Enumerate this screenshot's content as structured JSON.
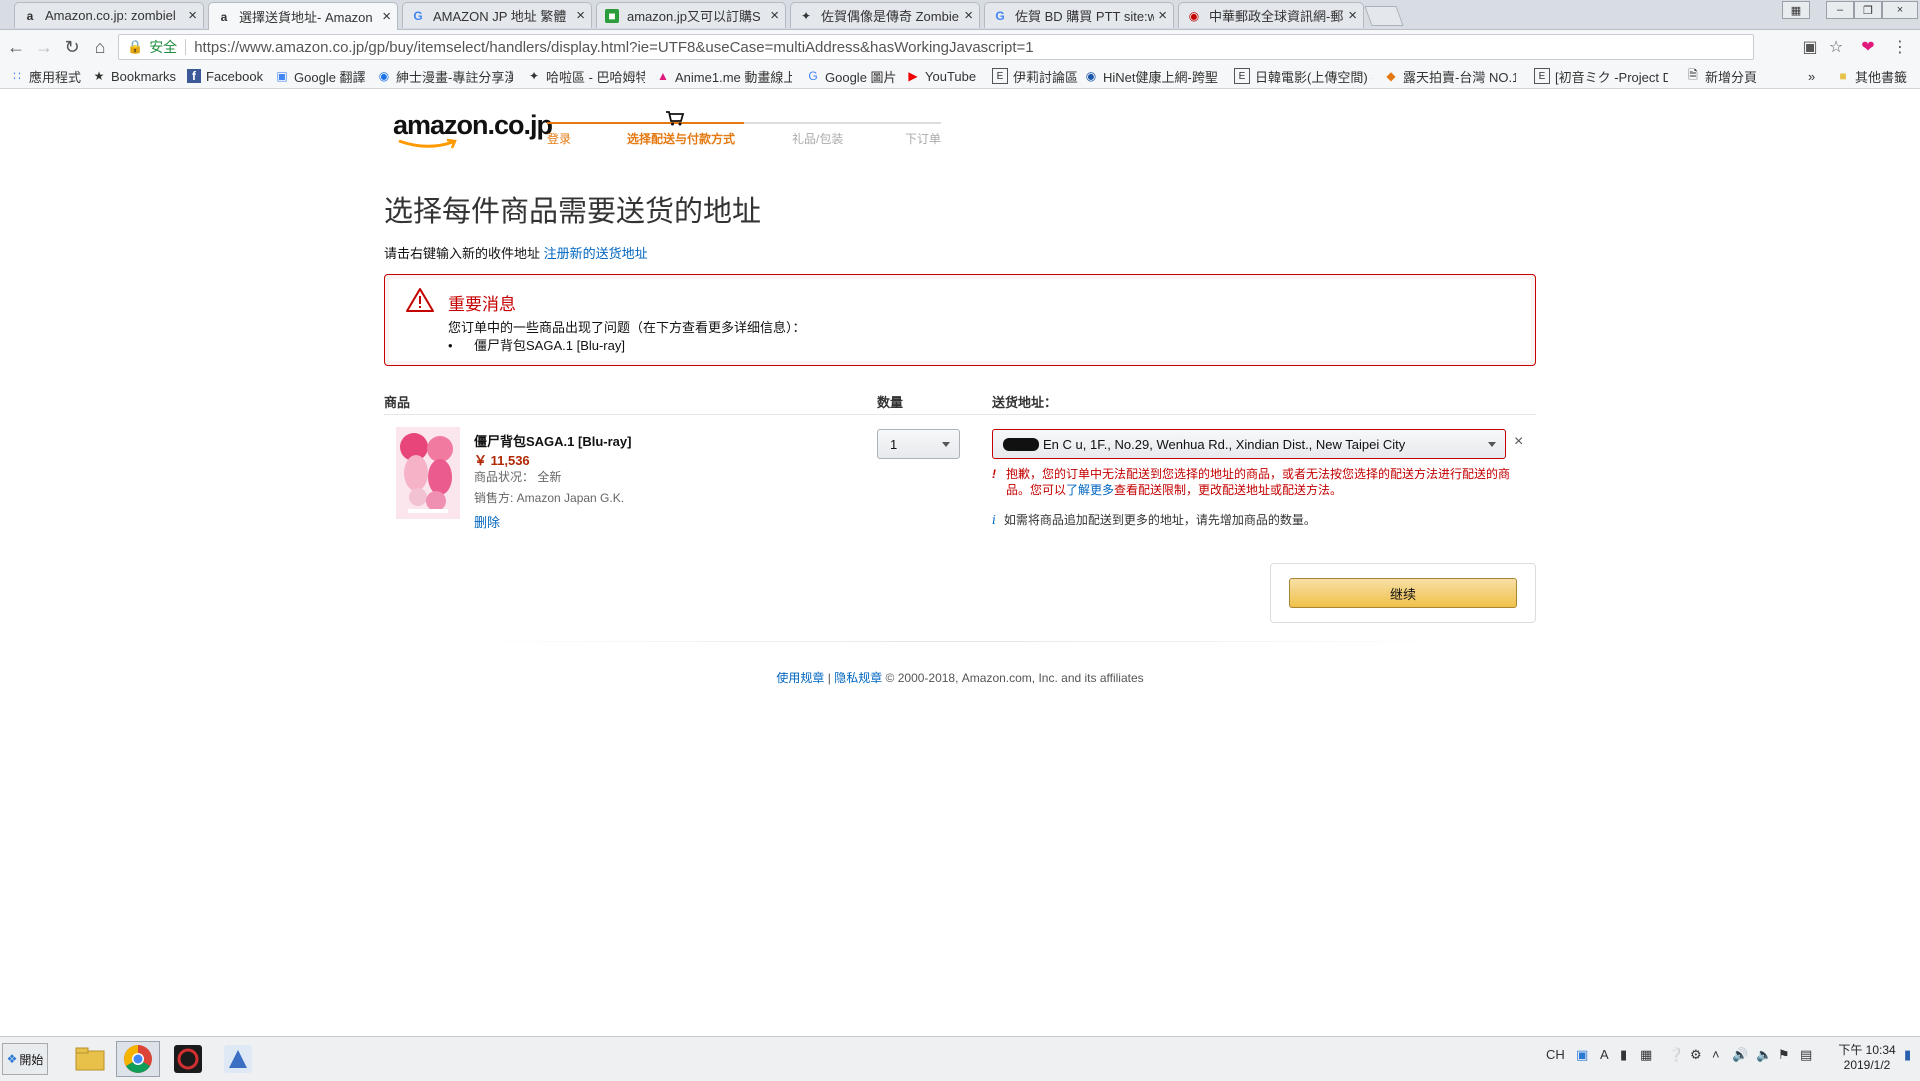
{
  "browser": {
    "tabs": [
      {
        "title": "Amazon.co.jp: zombiel",
        "favicon": "amazon-icon",
        "active": false
      },
      {
        "title": "選擇送貨地址- Amazon",
        "favicon": "amazon-icon",
        "active": true
      },
      {
        "title": "AMAZON JP 地址 繁體",
        "favicon": "google-icon",
        "active": false
      },
      {
        "title": "amazon.jp又可以訂購S",
        "favicon": "green-site-icon",
        "active": false
      },
      {
        "title": "佐賀偶像是傳奇 Zombie",
        "favicon": "bird-icon",
        "active": false
      },
      {
        "title": "佐賀 BD 購買 PTT site:w",
        "favicon": "google-icon",
        "active": false
      },
      {
        "title": "中華郵政全球資訊網-郵",
        "favicon": "post-icon",
        "active": false
      }
    ],
    "address_bar": {
      "security_label": "安全",
      "url": "https://www.amazon.co.jp/gp/buy/itemselect/handlers/display.html?ie=UTF8&useCase=multiAddress&hasWorkingJavascript=1"
    },
    "bookmarks": [
      {
        "label": "應用程式",
        "icon": "apps-grid-icon"
      },
      {
        "label": "Bookmarks",
        "icon": "star-icon"
      },
      {
        "label": "Facebook",
        "icon": "facebook-icon"
      },
      {
        "label": "Google 翻譯",
        "icon": "translate-icon"
      },
      {
        "label": "紳士漫畫-專註分享漢",
        "icon": "camera-icon"
      },
      {
        "label": "哈啦區 - 巴哈姆特",
        "icon": "bird-icon"
      },
      {
        "label": "Anime1.me 動畫線上",
        "icon": "anime-icon"
      },
      {
        "label": "Google 圖片",
        "icon": "google-icon"
      },
      {
        "label": "YouTube",
        "icon": "youtube-icon"
      },
      {
        "label": "伊莉討論區",
        "icon": "e-icon"
      },
      {
        "label": "HiNet健康上網-跨聖",
        "icon": "hinet-icon"
      },
      {
        "label": "日韓電影(上傳空間) -",
        "icon": "e-icon"
      },
      {
        "label": "露天拍賣-台灣 NO.1",
        "icon": "ruten-icon"
      },
      {
        "label": "[初音ミク -Project DI",
        "icon": "e-icon"
      },
      {
        "label": "新增分頁",
        "icon": "page-icon"
      }
    ],
    "bookmarks_more": "»",
    "other_bookmarks": "其他書籤"
  },
  "checkout": {
    "logo_text": "amazon.co.jp",
    "steps": [
      {
        "label": "登录",
        "state": "done"
      },
      {
        "label": "选择配送与付款方式",
        "state": "current"
      },
      {
        "label": "礼品/包装",
        "state": "pending"
      },
      {
        "label": "下订单",
        "state": "pending"
      }
    ],
    "progress_fraction": 0.5
  },
  "page": {
    "title": "选择每件商品需要送货的地址",
    "subline": "请击右键输入新的收件地址",
    "register_link": "注册新的送货地址"
  },
  "alert": {
    "title": "重要消息",
    "message": "您订单中的一些商品出现了问题（在下方查看更多详细信息）：",
    "items": [
      "僵尸背包SAGA.1 [Blu-ray]"
    ],
    "bullet": "•"
  },
  "table": {
    "headers": [
      "商品",
      "数量",
      "送货地址："
    ]
  },
  "item": {
    "title": "僵尸背包SAGA.1 [Blu-ray]",
    "price": "￥ 11,536",
    "condition": "商品状况： 全新",
    "seller": "销售方: Amazon Japan G.K.",
    "delete_label": "删除",
    "quantity": "1",
    "address": "En C   u, 1F., No.29, Wenhua Rd., Xindian Dist., New Taipei City",
    "error_prefix": "抱歉，您的订单中无法配送到您选择的地址的商品，或者无法按您选择的配送方法进行配送的商品。您可以",
    "error_link": "了解更多",
    "error_suffix": "查看配送限制，更改配送地址或配送方法。",
    "info": "如需将商品追加配送到更多的地址，请先增加商品的数量。"
  },
  "actions": {
    "continue_label": "继续"
  },
  "footer": {
    "terms": "使用规章",
    "separator": "|",
    "privacy": "隐私规章",
    "copyright": "© 2000-2018, Amazon.com, Inc. and its affiliates"
  },
  "taskbar": {
    "start_label": "開始",
    "lang": "CH",
    "time": "下午 10:34",
    "date": "2019/1/2"
  },
  "colors": {
    "accent_orange": "#e47911",
    "error_red": "#c40000",
    "link_blue": "#0066c0",
    "price_red": "#b12704",
    "button_yellow": "#f0c14b"
  }
}
